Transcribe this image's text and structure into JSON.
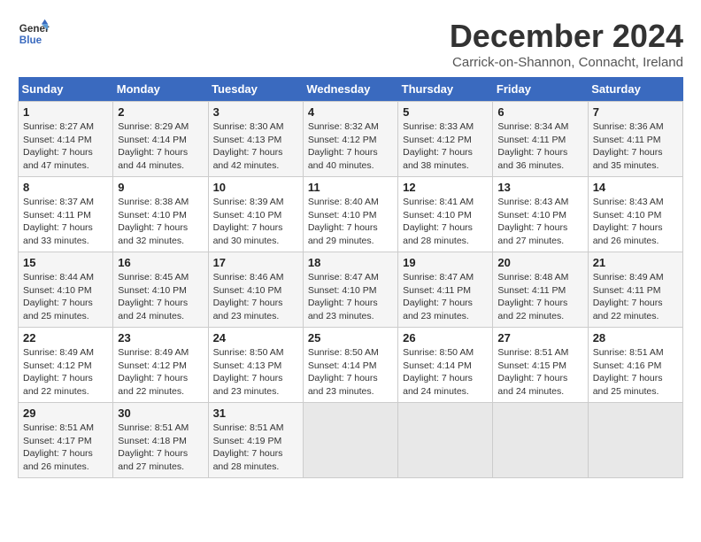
{
  "header": {
    "logo_line1": "General",
    "logo_line2": "Blue",
    "month": "December 2024",
    "location": "Carrick-on-Shannon, Connacht, Ireland"
  },
  "days_of_week": [
    "Sunday",
    "Monday",
    "Tuesday",
    "Wednesday",
    "Thursday",
    "Friday",
    "Saturday"
  ],
  "weeks": [
    [
      {
        "day": "1",
        "rise": "Sunrise: 8:27 AM",
        "set": "Sunset: 4:14 PM",
        "daylight": "Daylight: 7 hours and 47 minutes."
      },
      {
        "day": "2",
        "rise": "Sunrise: 8:29 AM",
        "set": "Sunset: 4:14 PM",
        "daylight": "Daylight: 7 hours and 44 minutes."
      },
      {
        "day": "3",
        "rise": "Sunrise: 8:30 AM",
        "set": "Sunset: 4:13 PM",
        "daylight": "Daylight: 7 hours and 42 minutes."
      },
      {
        "day": "4",
        "rise": "Sunrise: 8:32 AM",
        "set": "Sunset: 4:12 PM",
        "daylight": "Daylight: 7 hours and 40 minutes."
      },
      {
        "day": "5",
        "rise": "Sunrise: 8:33 AM",
        "set": "Sunset: 4:12 PM",
        "daylight": "Daylight: 7 hours and 38 minutes."
      },
      {
        "day": "6",
        "rise": "Sunrise: 8:34 AM",
        "set": "Sunset: 4:11 PM",
        "daylight": "Daylight: 7 hours and 36 minutes."
      },
      {
        "day": "7",
        "rise": "Sunrise: 8:36 AM",
        "set": "Sunset: 4:11 PM",
        "daylight": "Daylight: 7 hours and 35 minutes."
      }
    ],
    [
      {
        "day": "8",
        "rise": "Sunrise: 8:37 AM",
        "set": "Sunset: 4:11 PM",
        "daylight": "Daylight: 7 hours and 33 minutes."
      },
      {
        "day": "9",
        "rise": "Sunrise: 8:38 AM",
        "set": "Sunset: 4:10 PM",
        "daylight": "Daylight: 7 hours and 32 minutes."
      },
      {
        "day": "10",
        "rise": "Sunrise: 8:39 AM",
        "set": "Sunset: 4:10 PM",
        "daylight": "Daylight: 7 hours and 30 minutes."
      },
      {
        "day": "11",
        "rise": "Sunrise: 8:40 AM",
        "set": "Sunset: 4:10 PM",
        "daylight": "Daylight: 7 hours and 29 minutes."
      },
      {
        "day": "12",
        "rise": "Sunrise: 8:41 AM",
        "set": "Sunset: 4:10 PM",
        "daylight": "Daylight: 7 hours and 28 minutes."
      },
      {
        "day": "13",
        "rise": "Sunrise: 8:43 AM",
        "set": "Sunset: 4:10 PM",
        "daylight": "Daylight: 7 hours and 27 minutes."
      },
      {
        "day": "14",
        "rise": "Sunrise: 8:43 AM",
        "set": "Sunset: 4:10 PM",
        "daylight": "Daylight: 7 hours and 26 minutes."
      }
    ],
    [
      {
        "day": "15",
        "rise": "Sunrise: 8:44 AM",
        "set": "Sunset: 4:10 PM",
        "daylight": "Daylight: 7 hours and 25 minutes."
      },
      {
        "day": "16",
        "rise": "Sunrise: 8:45 AM",
        "set": "Sunset: 4:10 PM",
        "daylight": "Daylight: 7 hours and 24 minutes."
      },
      {
        "day": "17",
        "rise": "Sunrise: 8:46 AM",
        "set": "Sunset: 4:10 PM",
        "daylight": "Daylight: 7 hours and 23 minutes."
      },
      {
        "day": "18",
        "rise": "Sunrise: 8:47 AM",
        "set": "Sunset: 4:10 PM",
        "daylight": "Daylight: 7 hours and 23 minutes."
      },
      {
        "day": "19",
        "rise": "Sunrise: 8:47 AM",
        "set": "Sunset: 4:11 PM",
        "daylight": "Daylight: 7 hours and 23 minutes."
      },
      {
        "day": "20",
        "rise": "Sunrise: 8:48 AM",
        "set": "Sunset: 4:11 PM",
        "daylight": "Daylight: 7 hours and 22 minutes."
      },
      {
        "day": "21",
        "rise": "Sunrise: 8:49 AM",
        "set": "Sunset: 4:11 PM",
        "daylight": "Daylight: 7 hours and 22 minutes."
      }
    ],
    [
      {
        "day": "22",
        "rise": "Sunrise: 8:49 AM",
        "set": "Sunset: 4:12 PM",
        "daylight": "Daylight: 7 hours and 22 minutes."
      },
      {
        "day": "23",
        "rise": "Sunrise: 8:49 AM",
        "set": "Sunset: 4:12 PM",
        "daylight": "Daylight: 7 hours and 22 minutes."
      },
      {
        "day": "24",
        "rise": "Sunrise: 8:50 AM",
        "set": "Sunset: 4:13 PM",
        "daylight": "Daylight: 7 hours and 23 minutes."
      },
      {
        "day": "25",
        "rise": "Sunrise: 8:50 AM",
        "set": "Sunset: 4:14 PM",
        "daylight": "Daylight: 7 hours and 23 minutes."
      },
      {
        "day": "26",
        "rise": "Sunrise: 8:50 AM",
        "set": "Sunset: 4:14 PM",
        "daylight": "Daylight: 7 hours and 24 minutes."
      },
      {
        "day": "27",
        "rise": "Sunrise: 8:51 AM",
        "set": "Sunset: 4:15 PM",
        "daylight": "Daylight: 7 hours and 24 minutes."
      },
      {
        "day": "28",
        "rise": "Sunrise: 8:51 AM",
        "set": "Sunset: 4:16 PM",
        "daylight": "Daylight: 7 hours and 25 minutes."
      }
    ],
    [
      {
        "day": "29",
        "rise": "Sunrise: 8:51 AM",
        "set": "Sunset: 4:17 PM",
        "daylight": "Daylight: 7 hours and 26 minutes."
      },
      {
        "day": "30",
        "rise": "Sunrise: 8:51 AM",
        "set": "Sunset: 4:18 PM",
        "daylight": "Daylight: 7 hours and 27 minutes."
      },
      {
        "day": "31",
        "rise": "Sunrise: 8:51 AM",
        "set": "Sunset: 4:19 PM",
        "daylight": "Daylight: 7 hours and 28 minutes."
      },
      {
        "day": "",
        "rise": "",
        "set": "",
        "daylight": ""
      },
      {
        "day": "",
        "rise": "",
        "set": "",
        "daylight": ""
      },
      {
        "day": "",
        "rise": "",
        "set": "",
        "daylight": ""
      },
      {
        "day": "",
        "rise": "",
        "set": "",
        "daylight": ""
      }
    ]
  ]
}
